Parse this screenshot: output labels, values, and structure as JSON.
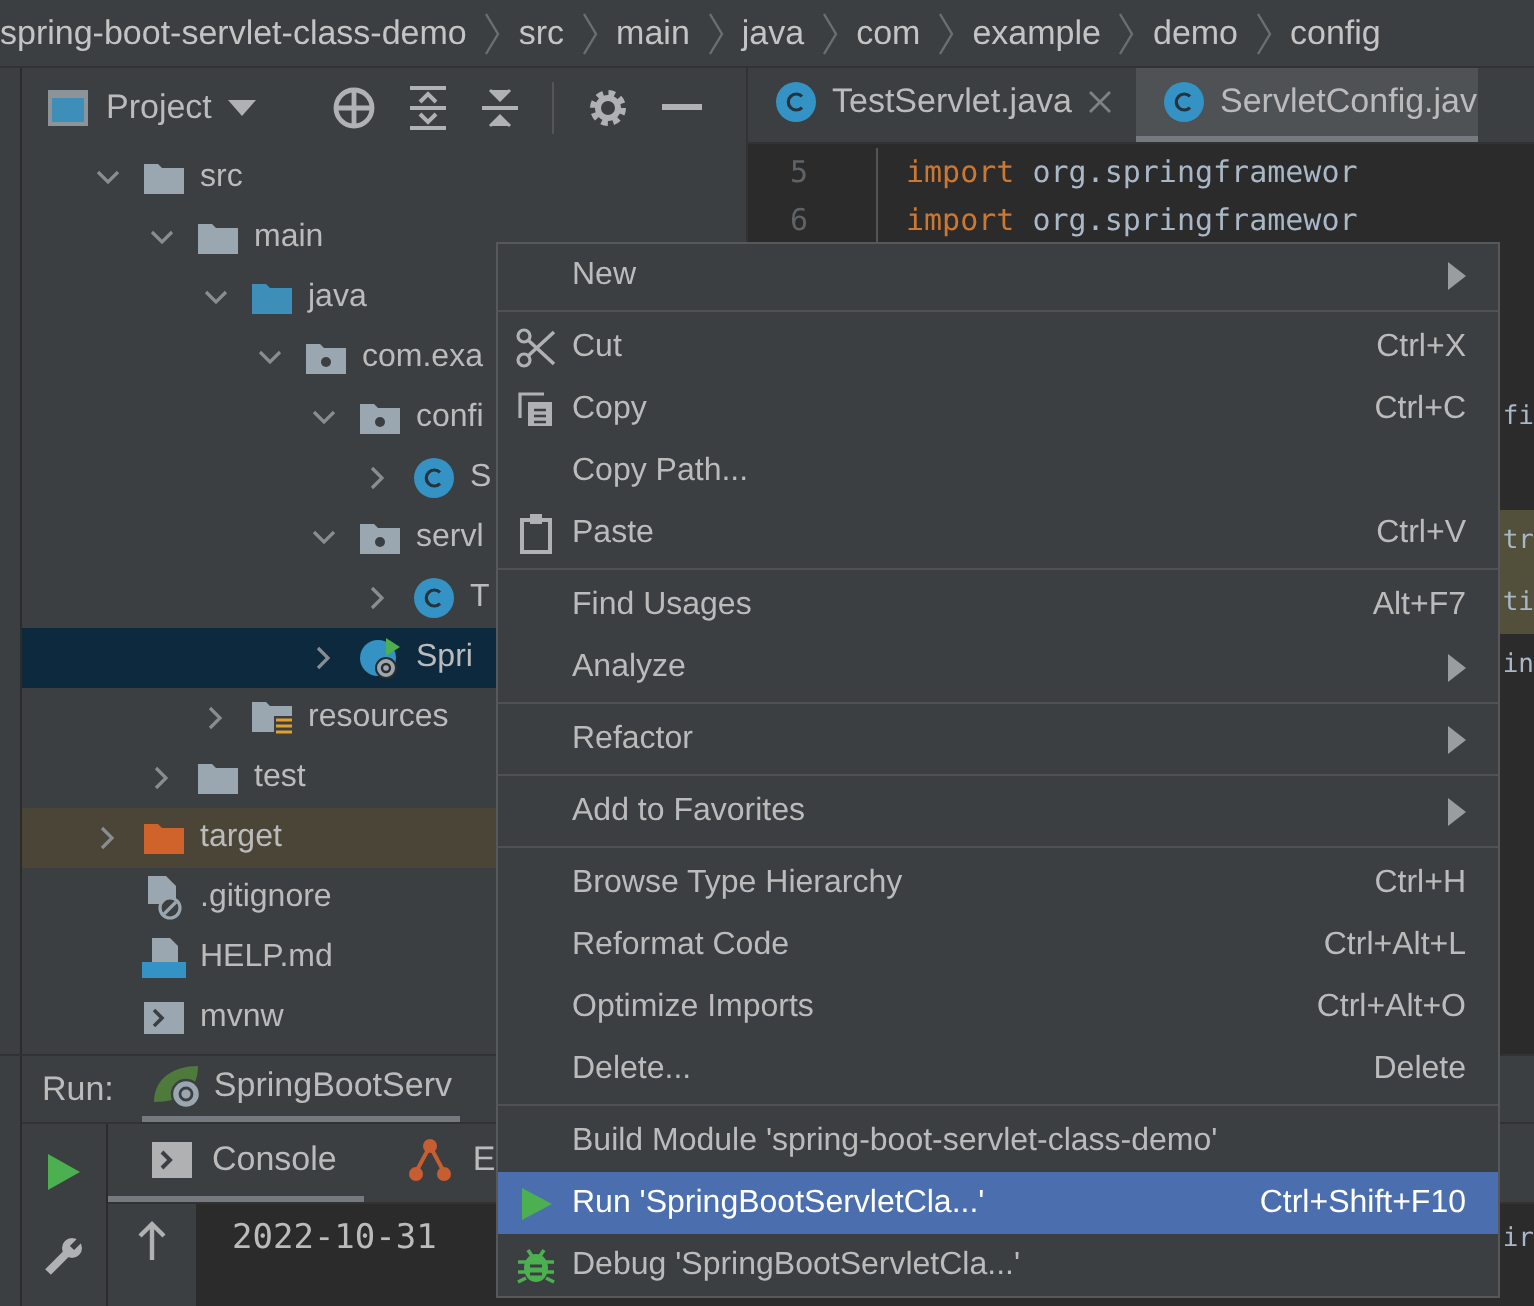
{
  "breadcrumbs": [
    "spring-boot-servlet-class-demo",
    "src",
    "main",
    "java",
    "com",
    "example",
    "demo",
    "config"
  ],
  "project_panel": {
    "title": "Project",
    "tree": [
      {
        "label": "src",
        "kind": "folder",
        "expanded": true,
        "selected": false,
        "children": [
          {
            "label": "main",
            "kind": "folder",
            "expanded": true,
            "selected": false,
            "children": [
              {
                "label": "java",
                "kind": "source-folder",
                "expanded": true,
                "selected": false,
                "children": [
                  {
                    "label": "com.exa",
                    "kind": "package",
                    "expanded": true,
                    "selected": false,
                    "children": [
                      {
                        "label": "confi",
                        "kind": "package",
                        "expanded": true,
                        "selected": false,
                        "children": [
                          {
                            "label": "S",
                            "kind": "class",
                            "expanded": false,
                            "selected": false
                          }
                        ]
                      },
                      {
                        "label": "servl",
                        "kind": "package",
                        "expanded": true,
                        "selected": false,
                        "children": [
                          {
                            "label": "T",
                            "kind": "class",
                            "expanded": false,
                            "selected": false
                          }
                        ]
                      },
                      {
                        "label": "Spri",
                        "kind": "spring-class",
                        "expanded": false,
                        "selected": true
                      }
                    ]
                  }
                ]
              },
              {
                "label": "resources",
                "kind": "resources-folder",
                "expanded": false,
                "selected": false
              }
            ]
          },
          {
            "label": "test",
            "kind": "folder",
            "expanded": false,
            "selected": false
          }
        ]
      },
      {
        "label": "target",
        "kind": "excluded-folder",
        "expanded": false,
        "selected": false
      },
      {
        "label": ".gitignore",
        "kind": "ignore-file",
        "selected": false
      },
      {
        "label": "HELP.md",
        "kind": "markdown-file",
        "selected": false
      },
      {
        "label": "mvnw",
        "kind": "script-file",
        "selected": false
      }
    ]
  },
  "editor": {
    "tabs": [
      {
        "label": "TestServlet.java",
        "selected": false,
        "closable": true
      },
      {
        "label": "ServletConfig.jav",
        "selected": true,
        "closable": false
      }
    ],
    "lines": [
      {
        "number": "5",
        "keyword": "import",
        "text": "org.springframewor"
      },
      {
        "number": "6",
        "keyword": "import",
        "text": "org.springframewor"
      },
      {
        "fragment": "fi",
        "highlighted": false
      },
      {
        "fragment": "tr",
        "highlighted": true
      },
      {
        "fragment": "ti",
        "highlighted": true
      },
      {
        "fragment": "in",
        "highlighted": false
      }
    ]
  },
  "run_panel": {
    "label": "Run:",
    "config_tab": "SpringBootServ",
    "tabs": [
      {
        "label": "Console",
        "kind": "console",
        "selected": true
      },
      {
        "label": "E",
        "kind": "endpoints",
        "selected": false
      }
    ],
    "console_lines": [
      {
        "text": "2022-10-31",
        "fragment": "ir"
      }
    ]
  },
  "context_menu": [
    {
      "kind": "item",
      "label": "New",
      "submenu": true,
      "selected": false
    },
    {
      "kind": "separator"
    },
    {
      "kind": "scissors-item",
      "label": "Cut",
      "shortcut": "Ctrl+X",
      "selected": false
    },
    {
      "kind": "copy-item",
      "label": "Copy",
      "shortcut": "Ctrl+C",
      "selected": false
    },
    {
      "kind": "item",
      "label": "Copy Path...",
      "selected": false
    },
    {
      "kind": "paste-item",
      "label": "Paste",
      "shortcut": "Ctrl+V",
      "selected": false
    },
    {
      "kind": "separator"
    },
    {
      "kind": "item",
      "label": "Find Usages",
      "shortcut": "Alt+F7",
      "selected": false
    },
    {
      "kind": "item",
      "label": "Analyze",
      "submenu": true,
      "selected": false
    },
    {
      "kind": "separator"
    },
    {
      "kind": "item",
      "label": "Refactor",
      "submenu": true,
      "selected": false
    },
    {
      "kind": "separator"
    },
    {
      "kind": "item",
      "label": "Add to Favorites",
      "submenu": true,
      "selected": false
    },
    {
      "kind": "separator"
    },
    {
      "kind": "item",
      "label": "Browse Type Hierarchy",
      "shortcut": "Ctrl+H",
      "selected": false
    },
    {
      "kind": "item",
      "label": "Reformat Code",
      "shortcut": "Ctrl+Alt+L",
      "selected": false
    },
    {
      "kind": "item",
      "label": "Optimize Imports",
      "shortcut": "Ctrl+Alt+O",
      "selected": false
    },
    {
      "kind": "item",
      "label": "Delete...",
      "shortcut": "Delete",
      "selected": false
    },
    {
      "kind": "separator"
    },
    {
      "kind": "item",
      "label": "Build Module 'spring-boot-servlet-class-demo'",
      "selected": false
    },
    {
      "kind": "run-item",
      "label": "Run 'SpringBootServletCla...'",
      "shortcut": "Ctrl+Shift+F10",
      "selected": true
    },
    {
      "kind": "debug-item",
      "label": "Debug 'SpringBootServletCla...'",
      "selected": false
    }
  ]
}
